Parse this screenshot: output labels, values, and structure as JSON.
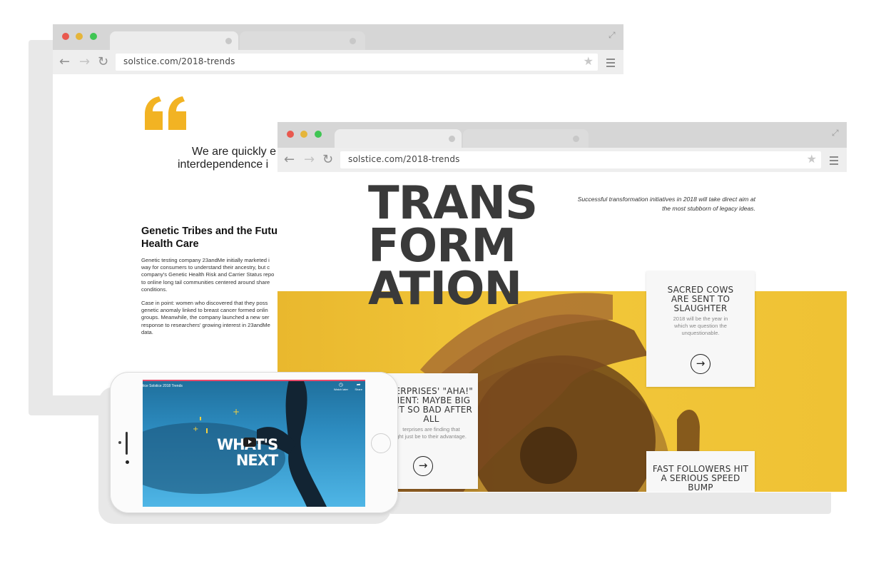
{
  "colors": {
    "quote_yellow": "#f2b323",
    "hero_yellow": "#f1c232",
    "video_blue": "#2b8fc0",
    "chrome_gray": "#d6d6d6"
  },
  "back_browser": {
    "url": "solstice.com/2018-trends",
    "quote_icon": "quote-marks-icon",
    "quote_line1": "We are quickly e",
    "quote_line2": "interdependence i",
    "article_title_line1": "Genetic Tribes and the Futu",
    "article_title_line2": "Health Care",
    "para1": [
      "Genetic testing company 23andMe initially marketed i",
      "way for consumers to understand their ancestry, but c",
      "company's Genetic Health Risk and Carrier Status repo",
      "to online long tail communities centered around share",
      "conditions."
    ],
    "para2": [
      "Case in point: women who discovered that they poss",
      "genetic anomaly linked to breast cancer formed onlin",
      "groups. Meanwhile, the company launched a new ser",
      "response to researchers' growing interest in 23andMe",
      "data."
    ]
  },
  "front_browser": {
    "url": "solstice.com/2018-trends",
    "headline": [
      "TRANS",
      "FORM",
      "ATION"
    ],
    "tagline_line1": "Successful transformation initiatives in 2018 will take direct aim at",
    "tagline_line2": "the most stubborn of legacy ideas.",
    "card_sacred": {
      "title": [
        "SACRED COWS",
        "ARE SENT TO",
        "SLAUGHTER"
      ],
      "sub": [
        "2018 will be the year in",
        "which we question the",
        "unquestionable."
      ]
    },
    "card_aha": {
      "title": [
        "TERPRISES' \"AHA!\"",
        "MENT: MAYBE BIG",
        "N'T SO BAD AFTER",
        "ALL"
      ],
      "sub": [
        "terprises are finding that",
        "ght just be to their advantage."
      ]
    },
    "card_fast": {
      "title": [
        "FAST FOLLOWERS HIT",
        "A SERIOUS SPEED",
        "BUMP"
      ]
    }
  },
  "phone": {
    "video_title": "tice  Solstice 2018 Trends",
    "watch_later": "Watch later",
    "share": "Share",
    "whats": "WHAT'S",
    "next": "NEXT"
  }
}
